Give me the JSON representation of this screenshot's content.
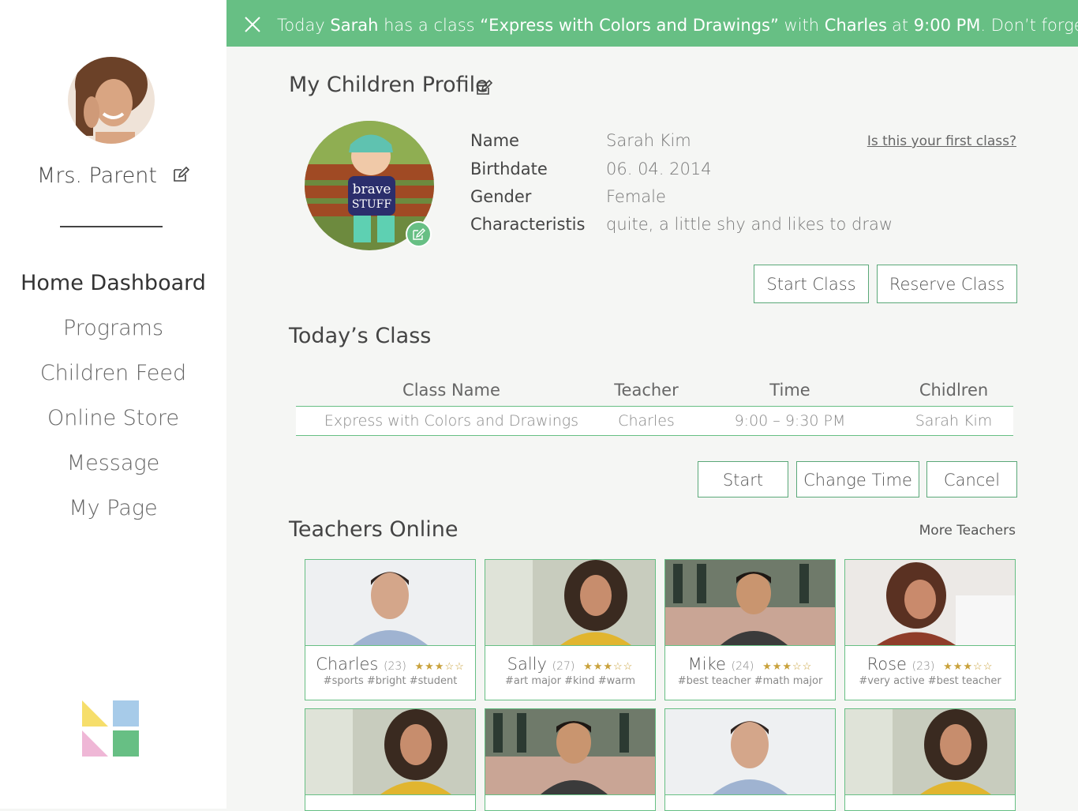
{
  "sidebar": {
    "parent_name": "Mrs. Parent",
    "nav": [
      "Home Dashboard",
      "Programs",
      "Children Feed",
      "Online Store",
      "Message",
      "My Page"
    ]
  },
  "banner": {
    "t1": "Today",
    "child": "Sarah",
    "t2": "has  a class",
    "class_name": "“Express with Colors and Drawings”",
    "t3": "with",
    "teacher": "Charles",
    "t4": "at",
    "time": "9:00 PM",
    "t5": ". Don’t forget!"
  },
  "profile": {
    "title": "My Children Profile",
    "first_class_link": "Is this your first class?",
    "fields": [
      {
        "label": "Name",
        "value": "Sarah Kim"
      },
      {
        "label": "Birthdate",
        "value": "06. 04. 2014"
      },
      {
        "label": "Gender",
        "value": "Female"
      },
      {
        "label": "Characteristis",
        "value": "quite, a little shy and likes to draw"
      }
    ],
    "start_button": "Start Class",
    "reserve_button": "Reserve Class"
  },
  "today": {
    "title": "Today’s Class",
    "columns": [
      "Class Name",
      "Teacher",
      "Time",
      "Chidlren"
    ],
    "rows": [
      [
        "Express with Colors and Drawings",
        "Charles",
        "9:00 – 9:30 PM",
        "Sarah Kim"
      ]
    ],
    "start": "Start",
    "change_time": "Change Time",
    "cancel": "Cancel"
  },
  "teachers": {
    "title": "Teachers Online",
    "more": "More Teachers",
    "cards": [
      {
        "name": "Charles",
        "age": "(23)",
        "rating": 3,
        "tags": "#sports #bright #student"
      },
      {
        "name": "Sally",
        "age": "(27)",
        "rating": 3,
        "tags": "#art major #kind #warm"
      },
      {
        "name": "Mike",
        "age": "(24)",
        "rating": 3,
        "tags": "#best teacher #math major"
      },
      {
        "name": "Rose",
        "age": "(23)",
        "rating": 3,
        "tags": "#very active #best teacher"
      }
    ]
  },
  "colors": {
    "accent": "#67bf84",
    "logo": [
      "#f6de6b",
      "#a7cbe9",
      "#efb7d6",
      "#67bf84"
    ]
  }
}
